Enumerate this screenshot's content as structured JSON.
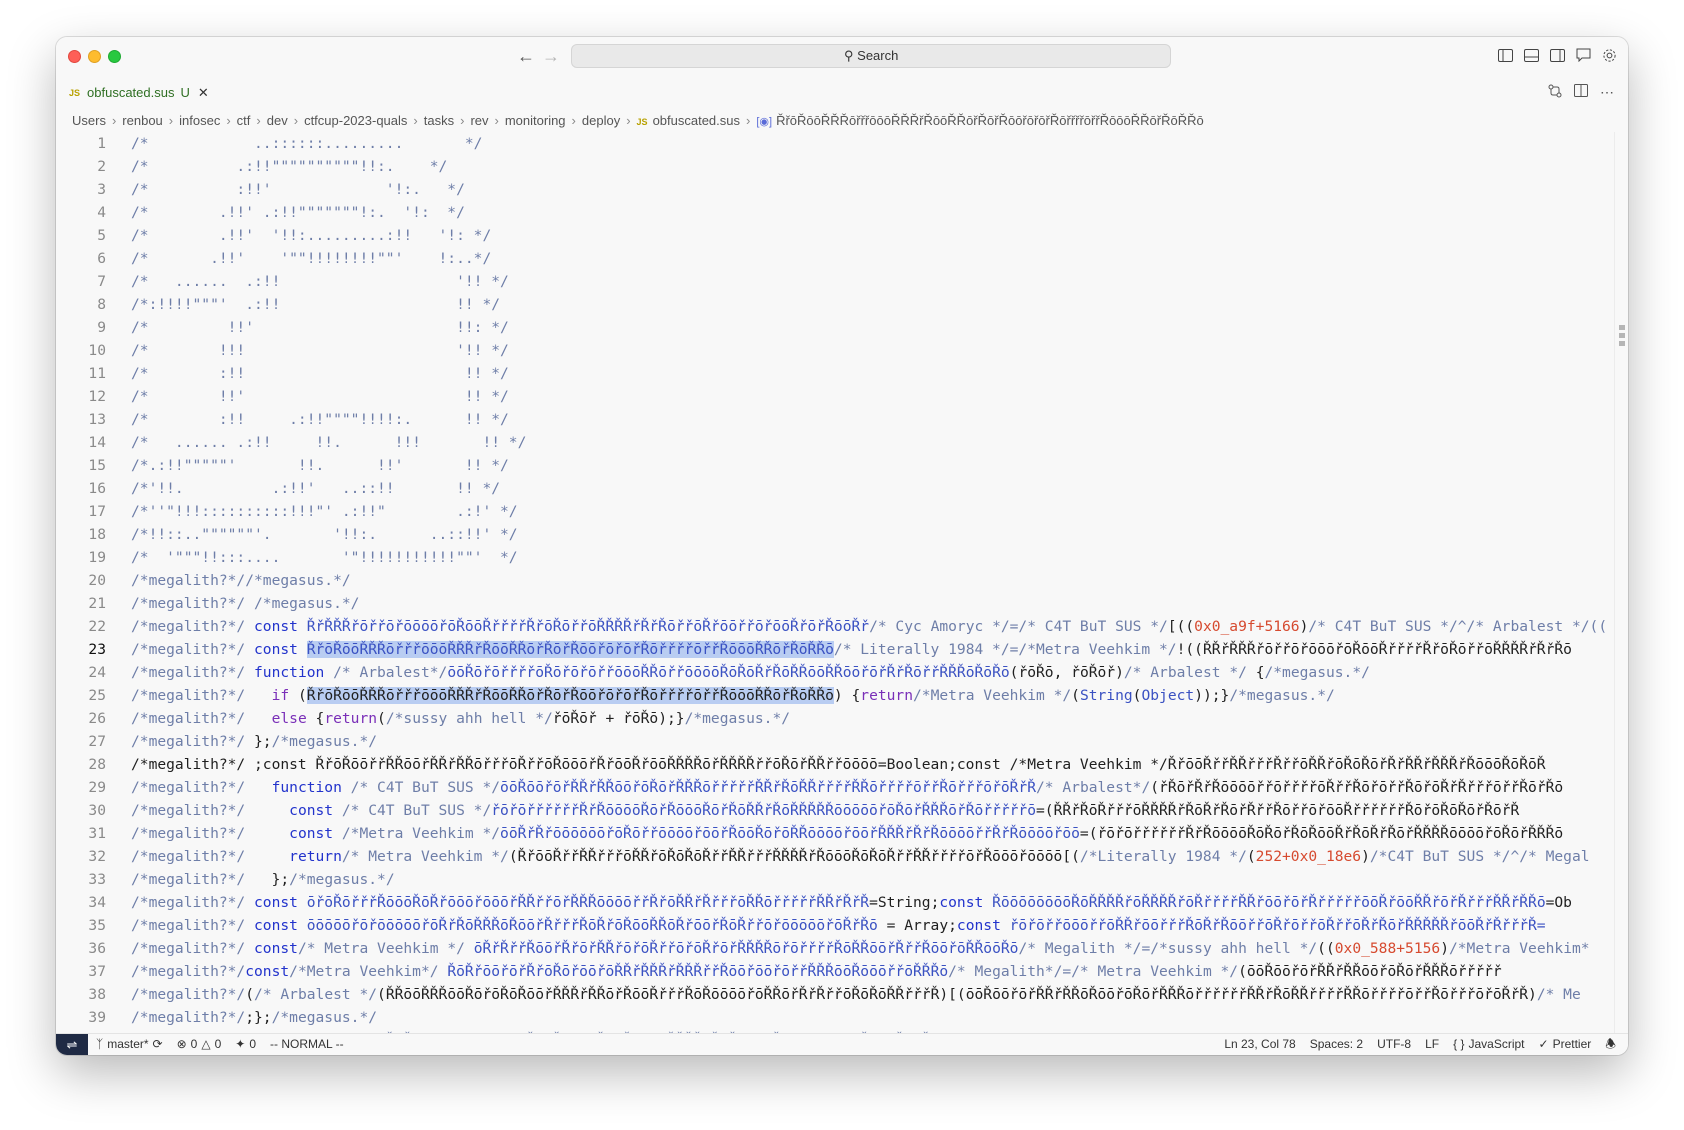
{
  "titlebar": {
    "search_label": "Search"
  },
  "tab": {
    "badge": "JS",
    "title": "obfuscated.sus",
    "modified": "U"
  },
  "breadcrumb": {
    "parts": [
      "Users",
      "renbou",
      "infosec",
      "ctf",
      "dev",
      "ctfcup-2023-quals",
      "tasks",
      "rev",
      "monitoring",
      "deploy"
    ],
    "file_badge": "JS",
    "file": "obfuscated.sus",
    "symbol": "ŘřōŘōōŘŘŘōřřřōōōŘŘŘřŘōōŘŘōřŘōřŘōōřōřōřŘōřřřřōřřŘōōōŘŘōřŘōŘŘō"
  },
  "editor": {
    "active_line": 23,
    "lines": [
      {
        "n": 1,
        "segs": [
          {
            "c": "cmt",
            "t": "/*            ..::::::.........       */"
          }
        ]
      },
      {
        "n": 2,
        "segs": [
          {
            "c": "cmt",
            "t": "/*          .:!!\"\"\"\"\"\"\"\"\"\"!!:.    */"
          }
        ]
      },
      {
        "n": 3,
        "segs": [
          {
            "c": "cmt",
            "t": "/*          :!!'             '!:.   */"
          }
        ]
      },
      {
        "n": 4,
        "segs": [
          {
            "c": "cmt",
            "t": "/*        .!!' .:!!\"\"\"\"\"\"\"!:.  '!:  */"
          }
        ]
      },
      {
        "n": 5,
        "segs": [
          {
            "c": "cmt",
            "t": "/*        .!!'  '!!:.........:!!   '!: */"
          }
        ]
      },
      {
        "n": 6,
        "segs": [
          {
            "c": "cmt",
            "t": "/*       .!!'    '\"\"!!!!!!!!\"\"'    !:..*/"
          }
        ]
      },
      {
        "n": 7,
        "segs": [
          {
            "c": "cmt",
            "t": "/*   ......  .:!!                    '!! */"
          }
        ]
      },
      {
        "n": 8,
        "segs": [
          {
            "c": "cmt",
            "t": "/*:!!!!\"\"\"'  .:!!                    !! */"
          }
        ]
      },
      {
        "n": 9,
        "segs": [
          {
            "c": "cmt",
            "t": "/*         !!'                       !!: */"
          }
        ]
      },
      {
        "n": 10,
        "segs": [
          {
            "c": "cmt",
            "t": "/*        !!!                        '!! */"
          }
        ]
      },
      {
        "n": 11,
        "segs": [
          {
            "c": "cmt",
            "t": "/*        :!!                         !! */"
          }
        ]
      },
      {
        "n": 12,
        "segs": [
          {
            "c": "cmt",
            "t": "/*        !!'                         !! */"
          }
        ]
      },
      {
        "n": 13,
        "segs": [
          {
            "c": "cmt",
            "t": "/*        :!!     .:!!\"\"\"\"!!!!:.      !! */"
          }
        ]
      },
      {
        "n": 14,
        "segs": [
          {
            "c": "cmt",
            "t": "/*   ...... .:!!     !!.      !!!       !! */"
          }
        ]
      },
      {
        "n": 15,
        "segs": [
          {
            "c": "cmt",
            "t": "/*.:!!\"\"\"\"\"'       !!.      !!'       !! */"
          }
        ]
      },
      {
        "n": 16,
        "segs": [
          {
            "c": "cmt",
            "t": "/*'!!.          .:!!'   ..::!!       !! */"
          }
        ]
      },
      {
        "n": 17,
        "segs": [
          {
            "c": "cmt",
            "t": "/*''\"!!!::::::::::!!!\"' .:!!\"        .:!' */"
          }
        ]
      },
      {
        "n": 18,
        "segs": [
          {
            "c": "cmt",
            "t": "/*!!::..\"\"\"\"\"\"'.       '!!:.      ..::!!' */"
          }
        ]
      },
      {
        "n": 19,
        "segs": [
          {
            "c": "cmt",
            "t": "/*  '\"\"\"!!:::....       '\"!!!!!!!!!!!\"\"'  */"
          }
        ]
      },
      {
        "n": 20,
        "segs": [
          {
            "c": "cmt",
            "t": "/*megalith?*//*megasus.*/"
          }
        ]
      },
      {
        "n": 21,
        "segs": [
          {
            "c": "cmt",
            "t": "/*megalith?*/ /*megasus.*/"
          }
        ]
      },
      {
        "n": 22,
        "segs": [
          {
            "c": "cmt",
            "t": "/*megalith?*/ "
          },
          {
            "c": "kw",
            "t": "const "
          },
          {
            "c": "id",
            "t": "ŘřŘŘŘřōřřōřōōōōřōŘōōŘřřřřŘřōŘōřřōŘŘŘŘřŘřŘōřřōŘřōōřřōřōōŘřōřŘōōŘř"
          },
          {
            "c": "cmt",
            "t": "/* Cyc Amoryc */=/* C4T BuT SUS */"
          },
          {
            "c": "dk",
            "t": "[(("
          },
          {
            "c": "num",
            "t": "0x0_a9f+5166"
          },
          {
            "c": "dk",
            "t": ")"
          },
          {
            "c": "cmt",
            "t": "/* C4T BuT SUS */^/* Arbalest */(("
          }
        ]
      },
      {
        "n": 23,
        "segs": [
          {
            "c": "cmt",
            "t": "/*megalith?*/ "
          },
          {
            "c": "kw",
            "t": "const "
          },
          {
            "c": "sel",
            "t": "ŘřōŘōōŘŘŘōřřřōōōŘŘŘřŘōōŘŘōřŘōřŘōōřōřōřŘōřřřřōřřŘōōōŘŘōřŘōŘŘō"
          },
          {
            "c": "cmt",
            "t": "/* Literally 1984 */=/*Metra Veehkim */"
          },
          {
            "c": "dk",
            "t": "!(("
          },
          {
            "c": "dk",
            "t": "ŘŘřŘŘŘřōřřōřōōōřōŘōōŘřřřřŘřōŘōřřōŘŘŘŘřŘřŘō"
          }
        ]
      },
      {
        "n": 24,
        "segs": [
          {
            "c": "cmt",
            "t": "/*megalith?*/ "
          },
          {
            "c": "kw",
            "t": "function "
          },
          {
            "c": "cmt",
            "t": "/* Arbalest*/"
          },
          {
            "c": "id",
            "t": "ōōŘōřōřřřřōŘōřōřōřřōōōŘŘōřřōōōōŘōŘōŘřŘōŘŘōōŘŘōōřōřŘřŘōřřŘŘŘōŘōŘō"
          },
          {
            "c": "dk",
            "t": "(řōŘō, řōŘōř)"
          },
          {
            "c": "cmt",
            "t": "/* Arbalest */ "
          },
          {
            "c": "dk",
            "t": "{"
          },
          {
            "c": "cmt",
            "t": "/*megasus.*/"
          }
        ]
      },
      {
        "n": 25,
        "segs": [
          {
            "c": "cmt",
            "t": "/*megalith?*/   "
          },
          {
            "c": "kw2",
            "t": "if "
          },
          {
            "c": "dk",
            "t": "("
          },
          {
            "c": "selfaint",
            "t": "ŘřōŘōōŘŘŘōřřřōōōŘŘŘřŘōōŘŘōřŘōřŘōōřōřōřŘōřřřřōřřŘōōōŘŘōřŘōŘŘō"
          },
          {
            "c": "dk",
            "t": ") {"
          },
          {
            "c": "kw2",
            "t": "return"
          },
          {
            "c": "cmt",
            "t": "/*Metra Veehkim */"
          },
          {
            "c": "dk",
            "t": "("
          },
          {
            "c": "id",
            "t": "String"
          },
          {
            "c": "dk",
            "t": "("
          },
          {
            "c": "id",
            "t": "Object"
          },
          {
            "c": "dk",
            "t": "));}"
          },
          {
            "c": "cmt",
            "t": "/*megasus.*/"
          }
        ]
      },
      {
        "n": 26,
        "segs": [
          {
            "c": "cmt",
            "t": "/*megalith?*/   "
          },
          {
            "c": "kw2",
            "t": "else "
          },
          {
            "c": "dk",
            "t": "{"
          },
          {
            "c": "kw2",
            "t": "return"
          },
          {
            "c": "dk",
            "t": "("
          },
          {
            "c": "cmt",
            "t": "/*sussy ahh hell */"
          },
          {
            "c": "dk",
            "t": "řōŘōř + řōŘō);}"
          },
          {
            "c": "cmt",
            "t": "/*megasus.*/"
          }
        ]
      },
      {
        "n": 27,
        "segs": [
          {
            "c": "cmt",
            "t": "/*megalith?*/ "
          },
          {
            "c": "dk",
            "t": "};"
          },
          {
            "c": "cmt",
            "t": "/*megasus.*/"
          }
        ]
      },
      {
        "n": 28,
        "segs": [
          {
            "c": "dk",
            "t": "/*megalith?*/ ;const ŘřōŘōōřřŘŘōōřŘŘřŘŘōřřřōŘřřōŘōōōřŘřōōŘřōōŘŘŘŘōřŘŘŘŘřřōŘōřŘŘřřōōōō=Boolean;const /*Metra Veehkim */ŘřōōŘřřŘŘřřřŘřřōŘŘřōŘōŘōřŘřŘŘřŘŘŘřŘōōōŘōŘōŘ"
          }
        ]
      },
      {
        "n": 29,
        "segs": [
          {
            "c": "cmt",
            "t": "/*megalith?*/   "
          },
          {
            "c": "kw",
            "t": "function "
          },
          {
            "c": "cmt",
            "t": "/* C4T BuT SUS */"
          },
          {
            "c": "id",
            "t": "ōōŘōōřōřŘŘřŘŘōōřōŘōřŘŘŘōřřřřřŘŘřŘōŘŘřřřřŘŘōřřřřōřřŘōřřřōřōŘřŘ"
          },
          {
            "c": "cmt",
            "t": "/* Arbalest*/"
          },
          {
            "c": "dk",
            "t": "(řŘōřŘřŘōōōōřřōřřřřōŘřřŘōřōřřŘōřōŘřŘřřřōřřŘōřŘō"
          }
        ]
      },
      {
        "n": 30,
        "segs": [
          {
            "c": "cmt",
            "t": "/*megalith?*/     "
          },
          {
            "c": "kw",
            "t": "const "
          },
          {
            "c": "cmt",
            "t": "/* C4T BuT SUS */"
          },
          {
            "c": "id",
            "t": "řōřōřřřřřřŘřŘōōōōŘōřŘōōōŘōřŘōŘŘřŘōŘŘŘŘŘōōōōōřōŘōřŘŘŘōřŘōřřřřřō"
          },
          {
            "c": "dk",
            "t": "=(ŘŘřŘōŘřřřōŘŘŘŘřŘōŘřŘōřŘřřŘōřřōřōōŘřřřřřřŘōřōŘōŘōřŘōřŘ"
          }
        ]
      },
      {
        "n": 31,
        "segs": [
          {
            "c": "cmt",
            "t": "/*megalith?*/     "
          },
          {
            "c": "kw",
            "t": "const "
          },
          {
            "c": "cmt",
            "t": "/*Metra Veehkim */"
          },
          {
            "c": "id",
            "t": "ōōŘřŘřōōōōōōřōŘōřřōōōōřōōřŘōōŘōřōŘŘōōōōřōōřŘŘŘřŘřŘōōōōřřŘřŘōōōōřōō"
          },
          {
            "c": "dk",
            "t": "=(řōřōřřřřřřŘřŘōōōōŘōŘōřŘōŘōōŘřŘōŘřŘōřŘŘŘŘōōōōřōŘōřŘŘŘō"
          }
        ]
      },
      {
        "n": 32,
        "segs": [
          {
            "c": "cmt",
            "t": "/*megalith?*/     "
          },
          {
            "c": "kw",
            "t": "return"
          },
          {
            "c": "cmt",
            "t": "/* Metra Veehkim */"
          },
          {
            "c": "dk",
            "t": "(ŘřōōŘřřŘŘřřřōŘŘřōŘōŘōŘřřŘŘřřřŘŘŘŘřŘōōōŘōŘōŘřřŘŘřřřřōřŘōōōřōōōō[("
          },
          {
            "c": "cmt",
            "t": "/*Literally 1984 */"
          },
          {
            "c": "dk",
            "t": "("
          },
          {
            "c": "num",
            "t": "252+0x0_18e6"
          },
          {
            "c": "dk",
            "t": ")"
          },
          {
            "c": "cmt",
            "t": "/*C4T BuT SUS */^/* Megal"
          }
        ]
      },
      {
        "n": 33,
        "segs": [
          {
            "c": "cmt",
            "t": "/*megalith?*/   "
          },
          {
            "c": "dk",
            "t": "};"
          },
          {
            "c": "cmt",
            "t": "/*megasus.*/"
          }
        ]
      },
      {
        "n": 34,
        "segs": [
          {
            "c": "cmt",
            "t": "/*megalith?*/ "
          },
          {
            "c": "kw",
            "t": "const "
          },
          {
            "c": "id",
            "t": "ōřōŘōřřřŘōōōŘōŘřōōōřōōōřŘŘřřōřŘŘŘōōōōřřŘřōŘŘřŘřřřōŘŘōřřřřřŘŘřŘřŘ"
          },
          {
            "c": "dk",
            "t": "=String;"
          },
          {
            "c": "kw",
            "t": "const "
          },
          {
            "c": "id",
            "t": "ŘōōōōōōōōŘōŘŘŘŘřōŘŘŘŘřōŘřřřřŘŘřōōřōřŘřřřřřōōŘřōōŘŘřōřŘřřřŘŘřŘŘō"
          },
          {
            "c": "dk",
            "t": "=Ob"
          }
        ]
      },
      {
        "n": 35,
        "segs": [
          {
            "c": "cmt",
            "t": "/*megalith?*/ "
          },
          {
            "c": "kw",
            "t": "const "
          },
          {
            "c": "id",
            "t": "ōōōōōřōřōōōōōřōŘřŘōŘŘŘōŘōōřŘřřřŘōŘřōŘōōŘŘōŘřōōřŘōŘřřōřōōōōōřōŘřŘō"
          },
          {
            "c": "dk",
            "t": " = Array;"
          },
          {
            "c": "kw",
            "t": "const "
          },
          {
            "c": "id",
            "t": "řōřōřřōōōřřōŘŘřōōřřřŘōŘřŘōōřřōŘřōřřōŘřřōŘřŘōřŘŘŘŘŘřōōŘřŘřřřŘ="
          }
        ]
      },
      {
        "n": 36,
        "segs": [
          {
            "c": "cmt",
            "t": "/*megalith?*/ "
          },
          {
            "c": "kw",
            "t": "const"
          },
          {
            "c": "cmt",
            "t": "/* Metra Veehkim */ "
          },
          {
            "c": "id",
            "t": "ōŘřŘřřŘōōřŘřōřŘŘřōřōŘřřōřōŘřōřŘŘŘŘōřōřřřřŘōŘŘōōřŘřřŘōōřōŘŘōōŘō"
          },
          {
            "c": "cmt",
            "t": "/* Megalith */=/*sussy ahh hell */"
          },
          {
            "c": "dk",
            "t": "(("
          },
          {
            "c": "num",
            "t": "0x0_588+5156"
          },
          {
            "c": "dk",
            "t": ")"
          },
          {
            "c": "cmt",
            "t": "/*Metra Veehkim*"
          }
        ]
      },
      {
        "n": 37,
        "segs": [
          {
            "c": "cmt",
            "t": "/*megalith?*/"
          },
          {
            "c": "kw",
            "t": "const"
          },
          {
            "c": "cmt",
            "t": "/*Metra Veehkim*/ "
          },
          {
            "c": "id",
            "t": "ŘōŘřōōřōřŘřōŘōřōōřōŘŘřŘŘŘřŘŘŘřřŘōōřōōřōřřŘŘŘōōŘōōōřřōŘŘŘō"
          },
          {
            "c": "cmt",
            "t": "/* Megalith*/=/* Metra Veehkim */"
          },
          {
            "c": "dk",
            "t": "(ōōŘōōřōřŘŘřŘŘōōřōŘōřŘŘŘōřřřřř"
          }
        ]
      },
      {
        "n": 38,
        "segs": [
          {
            "c": "cmt",
            "t": "/*megalith?*/"
          },
          {
            "c": "dk",
            "t": "("
          },
          {
            "c": "cmt",
            "t": "/* Arbalest */"
          },
          {
            "c": "dk",
            "t": "(ŘŘōōŘŘŘōōŘōřōŘōŘōōřŘŘŘřŘŘōřŘōōŘřřřŘōŘōōōōřōŘŘōřŘřŘřřōŘōŘōŘŘřřřŘ)[(ōōŘōōřōřŘŘřŘŘōŘōōřōŘōřŘŘŘōřřřřřřŘŘřŘōŘŘřřřřŘŘōřřřřōřřŘōřřřōřōŘřŘ)"
          },
          {
            "c": "cmt",
            "t": "/* Me"
          }
        ]
      },
      {
        "n": 39,
        "segs": [
          {
            "c": "cmt",
            "t": "/*megalith?*/"
          },
          {
            "c": "dk",
            "t": ";};"
          },
          {
            "c": "cmt",
            "t": "/*megasus.*/"
          }
        ]
      }
    ],
    "partial_line": "/*megalith?*/ C4T BuT SUS */ ŘřŘřřřōřōřōōōōřōŘōōŘřřřřŘřōŘōřřōŘŘŘŘřŘřŘōřřōŘřōōřřōřōōŘřōřŘōōŘř /*megasus.*/"
  },
  "statusbar": {
    "branch": "master*",
    "errors": "0",
    "warnings": "0",
    "ports": "0",
    "mode": "-- NORMAL --",
    "position": "Ln 23, Col 78",
    "spaces": "Spaces: 2",
    "encoding": "UTF-8",
    "eol": "LF",
    "language": "JavaScript",
    "formatter": "Prettier"
  },
  "colors": {
    "keyword": "#2233cc",
    "control": "#7a2fb8",
    "identifier": "#3a51c2",
    "number": "#d64a2f",
    "comment": "#6e7ea8",
    "selection": "#b9cdf2",
    "tab_modified": "#2f6f23"
  }
}
